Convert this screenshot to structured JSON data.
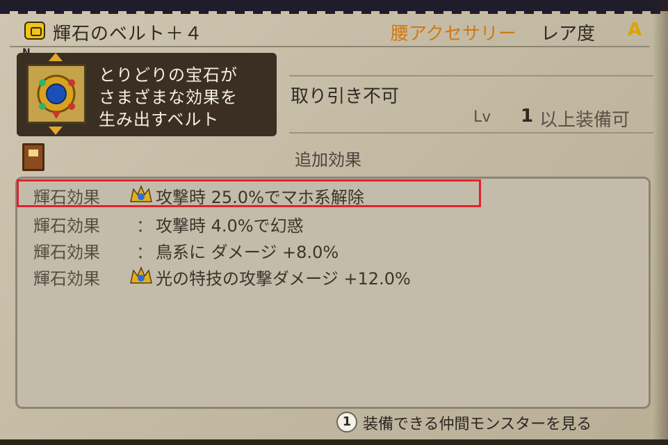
{
  "item": {
    "rank_letter": "N",
    "icon": "belt-badge-icon",
    "name": "輝石のベルト＋４",
    "category": "腰アクセサリー",
    "rarity_label": "レア度",
    "rarity_value": "A",
    "description_lines": [
      "とりどりの宝石が",
      "さまざまな効果を",
      "生み出すベルト"
    ],
    "trade_status": "取り引き不可",
    "level_label": "Lv",
    "level_value": "1",
    "level_requirement": "以上装備可"
  },
  "effects": {
    "title": "追加効果",
    "rows": [
      {
        "label": "輝石効果",
        "icon": "gem-crown-icon",
        "text": "攻撃時 25.0%でマホ系解除",
        "highlighted": true
      },
      {
        "label": "輝石効果",
        "separator": "：",
        "text": "攻撃時 4.0%で幻惑"
      },
      {
        "label": "輝石効果",
        "separator": "：",
        "text": "鳥系に ダメージ +8.0%"
      },
      {
        "label": "輝石効果",
        "icon": "gem-crown-icon",
        "text": "光の特技の攻撃ダメージ +12.0%"
      }
    ]
  },
  "footer": {
    "button_label": "1",
    "action_text": "装備できる仲間モンスターを見る"
  },
  "colors": {
    "highlight_border": "#e2202c",
    "category": "#d1790f",
    "rarity": "#d9a400",
    "desc_box": "#3a2f22"
  }
}
